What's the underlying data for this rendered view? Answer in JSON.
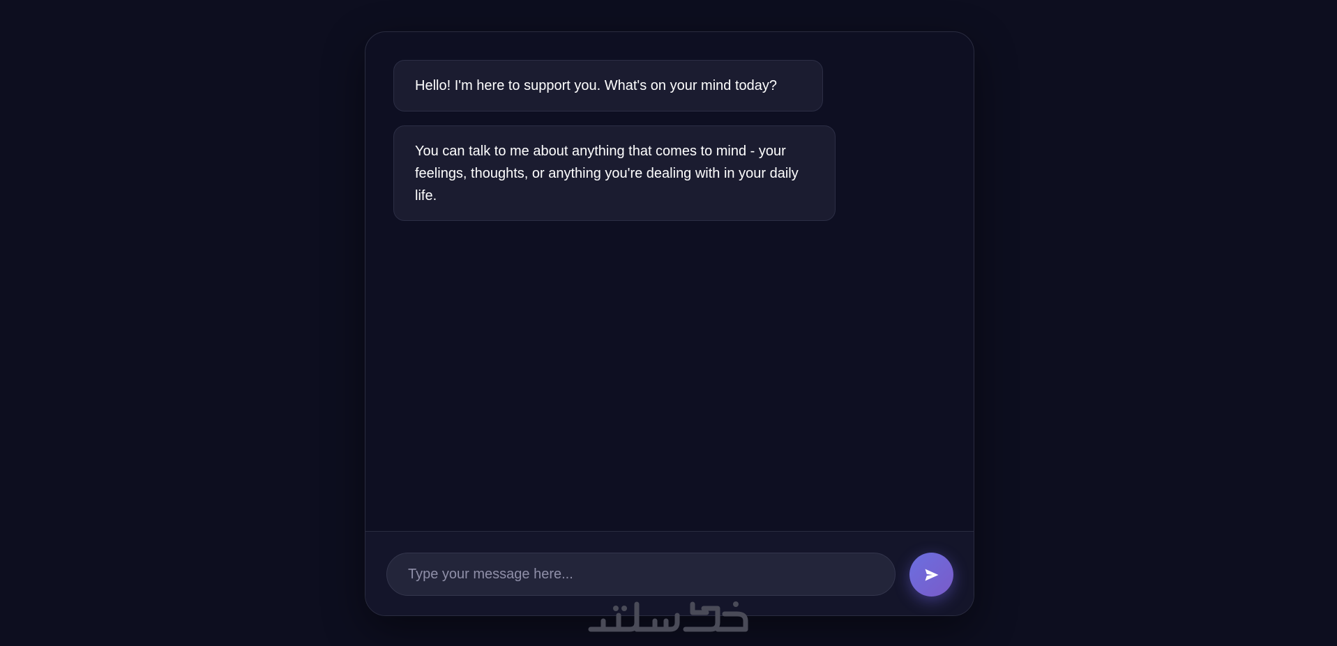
{
  "messages": [
    {
      "sender": "bot",
      "text": "Hello! I'm here to support you. What's on your mind today?"
    },
    {
      "sender": "bot",
      "text": "You can talk to me about anything that comes to mind - your feelings, thoughts, or anything you're dealing with in your daily life."
    }
  ],
  "composer": {
    "placeholder": "Type your message here...",
    "value": "",
    "send_icon": "send-icon"
  },
  "watermark": {
    "text": "خمسات"
  },
  "colors": {
    "background": "#0d0e1f",
    "bubble": "#1b1c30",
    "accent": "#6b6fe0"
  }
}
